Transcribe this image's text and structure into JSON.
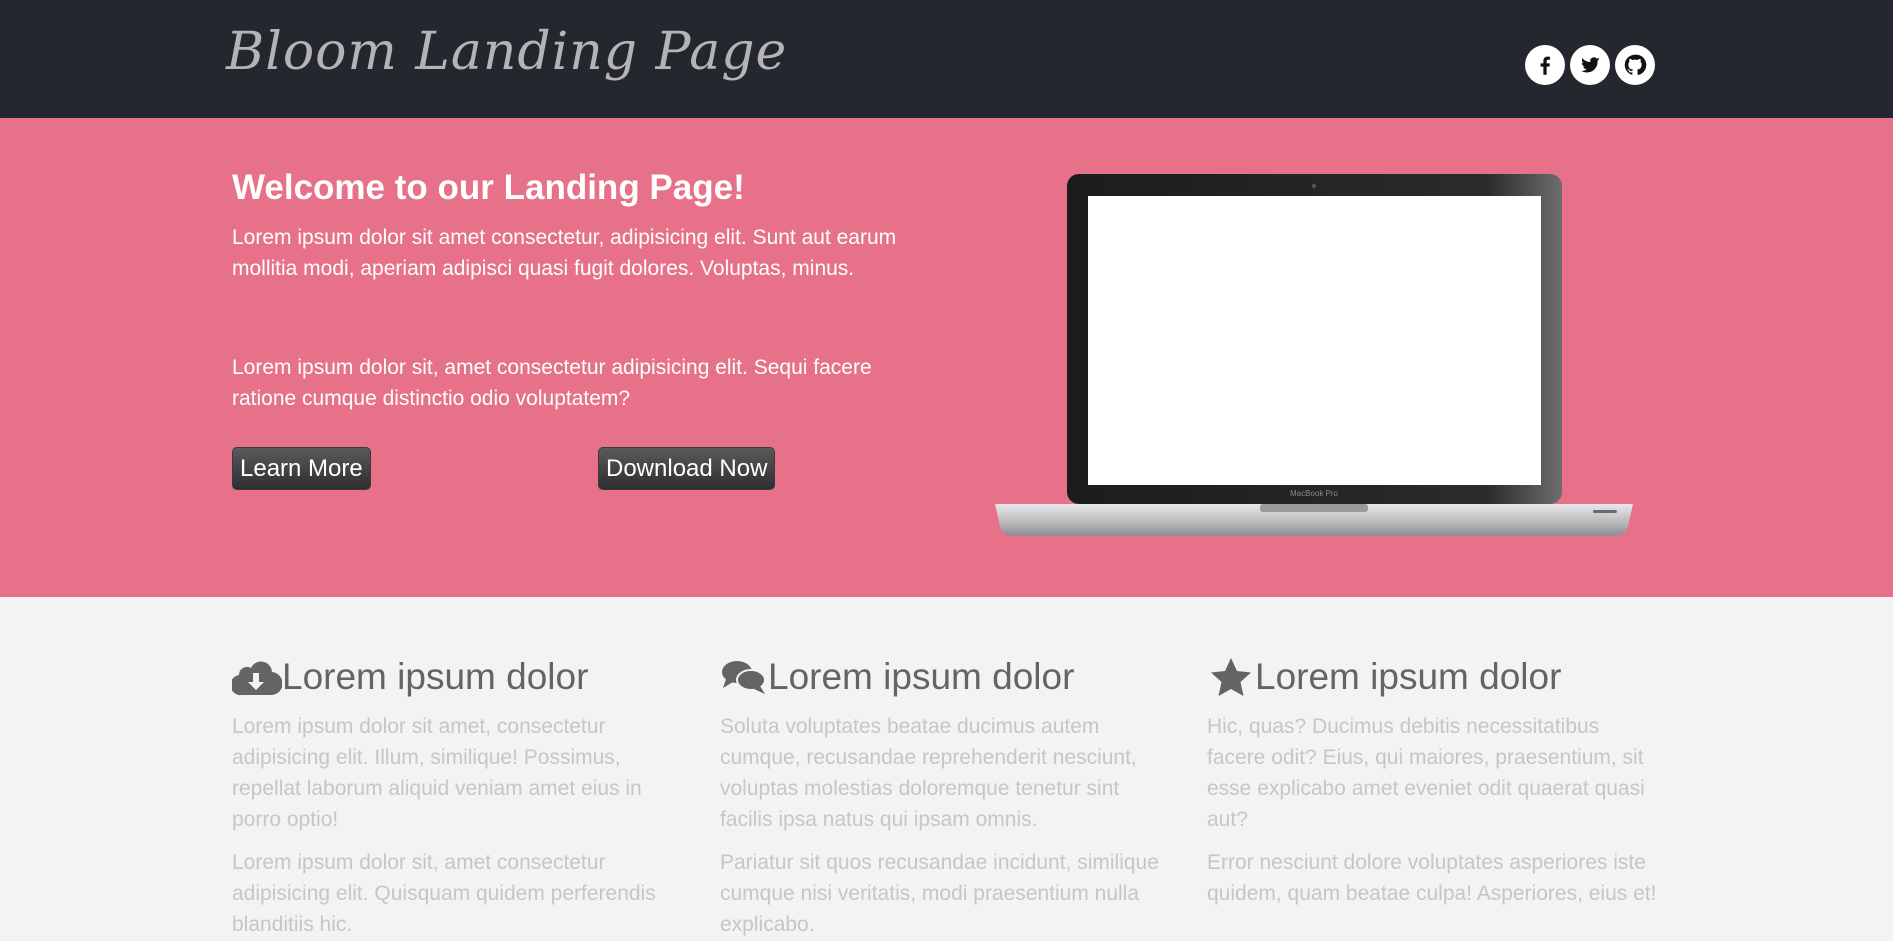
{
  "header": {
    "logo": "Bloom Landing Page",
    "social": [
      {
        "name": "facebook-icon"
      },
      {
        "name": "twitter-icon"
      },
      {
        "name": "github-icon"
      }
    ]
  },
  "hero": {
    "title": "Welcome to our Landing Page!",
    "paragraph1": "Lorem ipsum dolor sit amet consectetur, adipisicing elit. Sunt aut earum mollitia modi, aperiam adipisci quasi fugit dolores. Voluptas, minus.",
    "paragraph2": "Lorem ipsum dolor sit, amet consectetur adipisicing elit. Sequi facere ratione cumque distinctio odio voluptatem?",
    "learn_more": "Learn More",
    "download_now": "Download Now",
    "image": "laptop-image",
    "laptop_label": "MacBook Pro"
  },
  "features": [
    {
      "icon": "cloud-download-icon",
      "title": "Lorem ipsum dolor",
      "p1": "Lorem ipsum dolor sit amet, consectetur adipisicing elit. Illum, similique! Possimus, repellat laborum aliquid veniam amet eius in porro optio!",
      "p2": "Lorem ipsum dolor sit, amet consectetur adipisicing elit. Quisquam quidem perferendis blanditiis hic."
    },
    {
      "icon": "comments-icon",
      "title": "Lorem ipsum dolor",
      "p1": "Soluta voluptates beatae ducimus autem cumque, recusandae reprehenderit nesciunt, voluptas molestias doloremque tenetur sint facilis ipsa natus qui ipsam omnis.",
      "p2": "Pariatur sit quos recusandae incidunt, similique cumque nisi veritatis, modi praesentium nulla explicabo."
    },
    {
      "icon": "star-icon",
      "title": "Lorem ipsum dolor",
      "p1": "Hic, quas? Ducimus debitis necessitatibus facere odit? Eius, qui maiores, praesentium, sit esse explicabo amet eveniet odit quaerat quasi aut?",
      "p2": "Error nesciunt dolore voluptates asperiores iste quidem, quam beatae culpa! Asperiores, eius et!"
    }
  ],
  "colors": {
    "header_bg": "#24272d",
    "hero_bg": "#e67188",
    "features_bg": "#f3f3f5",
    "button_bg": "#3b3b3e"
  }
}
